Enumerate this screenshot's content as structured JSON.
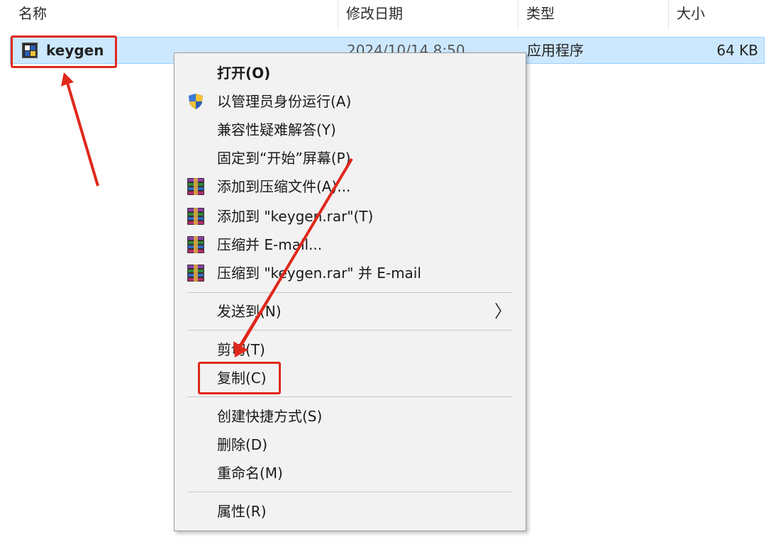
{
  "columns": {
    "name": "名称",
    "modified": "修改日期",
    "type": "类型",
    "size": "大小"
  },
  "file": {
    "name": "keygen",
    "modified": "2024/10/14 8:50",
    "type": "应用程序",
    "size": "64 KB",
    "icon": "application-icon"
  },
  "menu": {
    "open": "打开(O)",
    "run_as_admin": "以管理员身份运行(A)",
    "troubleshoot": "兼容性疑难解答(Y)",
    "pin_start": "固定到“开始”屏幕(P)",
    "add_archive": "添加到压缩文件(A)...",
    "add_rar": "添加到 \"keygen.rar\"(T)",
    "compress_email": "压缩并 E-mail...",
    "compress_rar_email": "压缩到 \"keygen.rar\" 并 E-mail",
    "send_to": "发送到(N)",
    "cut": "剪切(T)",
    "copy": "复制(C)",
    "create_shortcut": "创建快捷方式(S)",
    "delete": "删除(D)",
    "rename": "重命名(M)",
    "properties": "属性(R)"
  },
  "colors": {
    "selection": "#cce8ff",
    "annotation": "#e0281c",
    "menu_bg": "#f2f2f2"
  }
}
